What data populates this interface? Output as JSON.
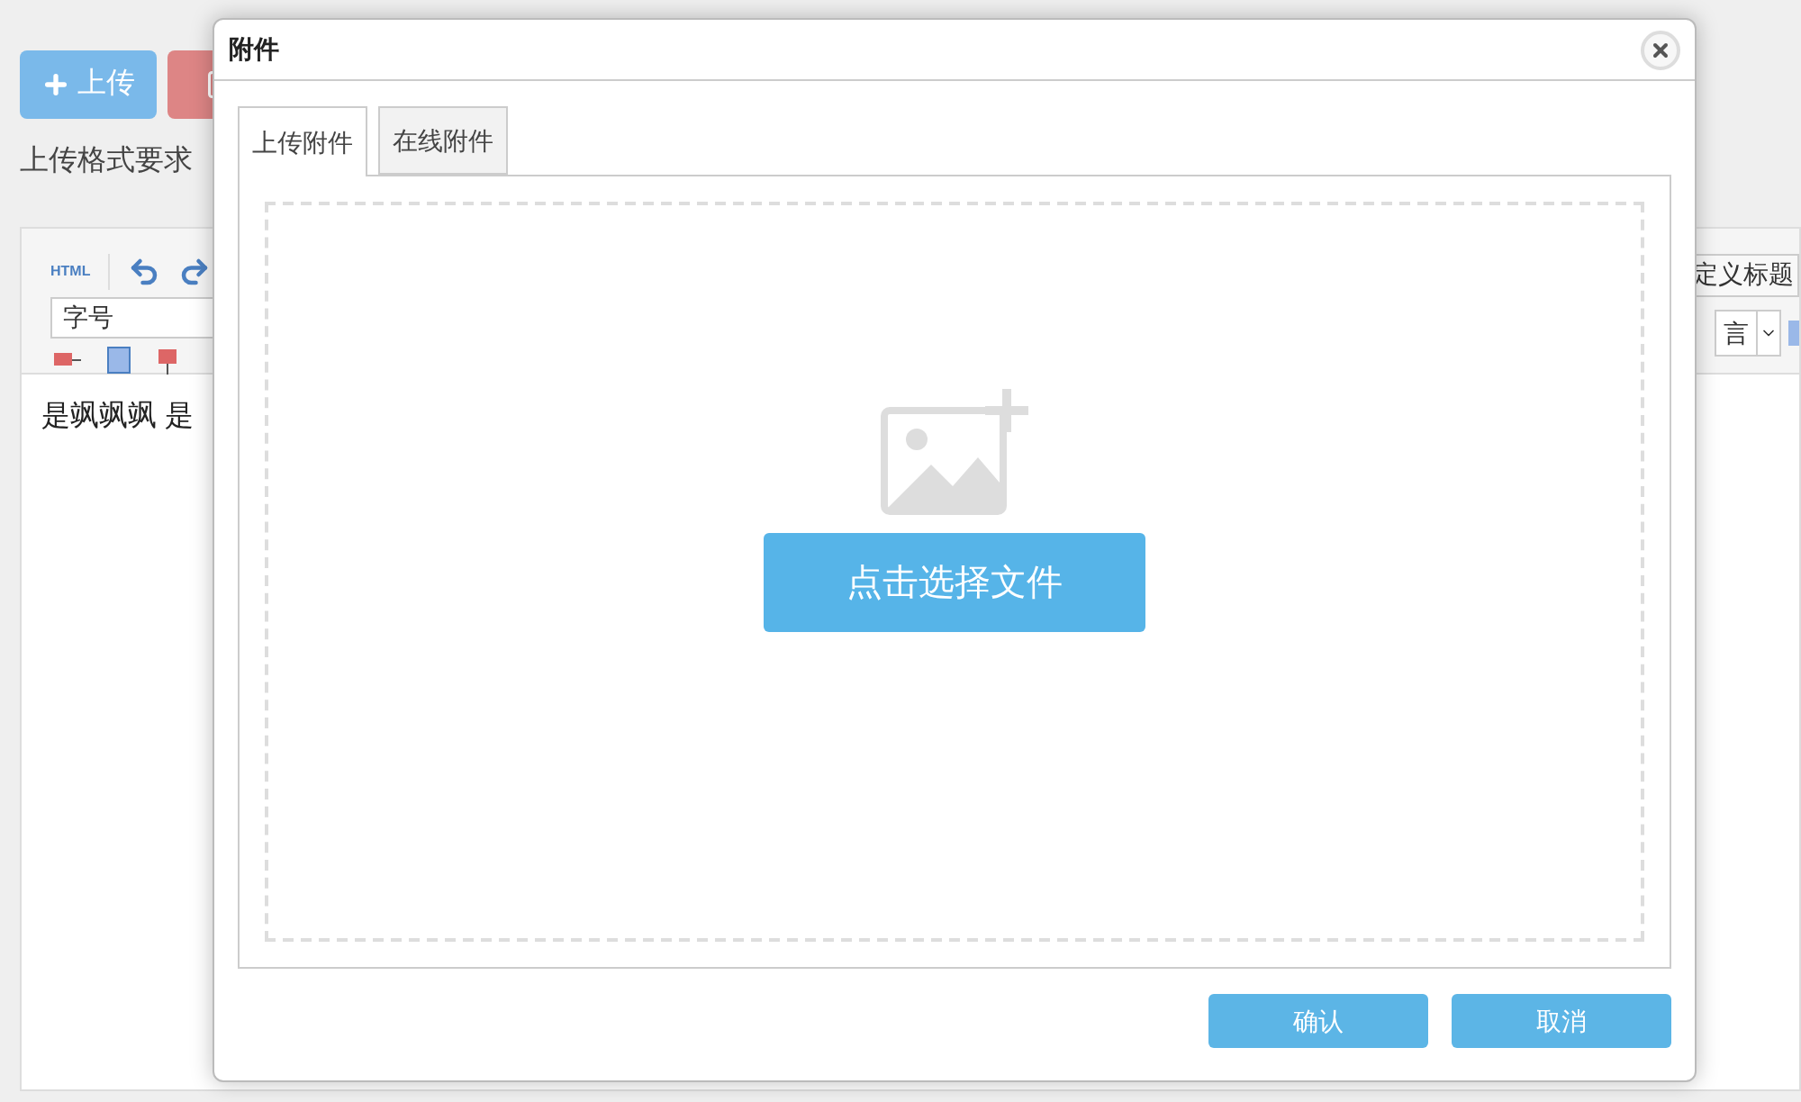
{
  "page": {
    "upload_button": "上传",
    "format_note": "上传格式要求",
    "editor": {
      "html_button": "HTML",
      "font_size_select": "字号",
      "custom_title": "定义标题",
      "language_select": "言",
      "content": "是飒飒飒 是"
    }
  },
  "dialog": {
    "title": "附件",
    "tabs": [
      {
        "label": "上传附件",
        "selected": true
      },
      {
        "label": "在线附件",
        "selected": false
      }
    ],
    "choose_file_button": "点击选择文件",
    "buttons": [
      "确认",
      "取消"
    ]
  }
}
